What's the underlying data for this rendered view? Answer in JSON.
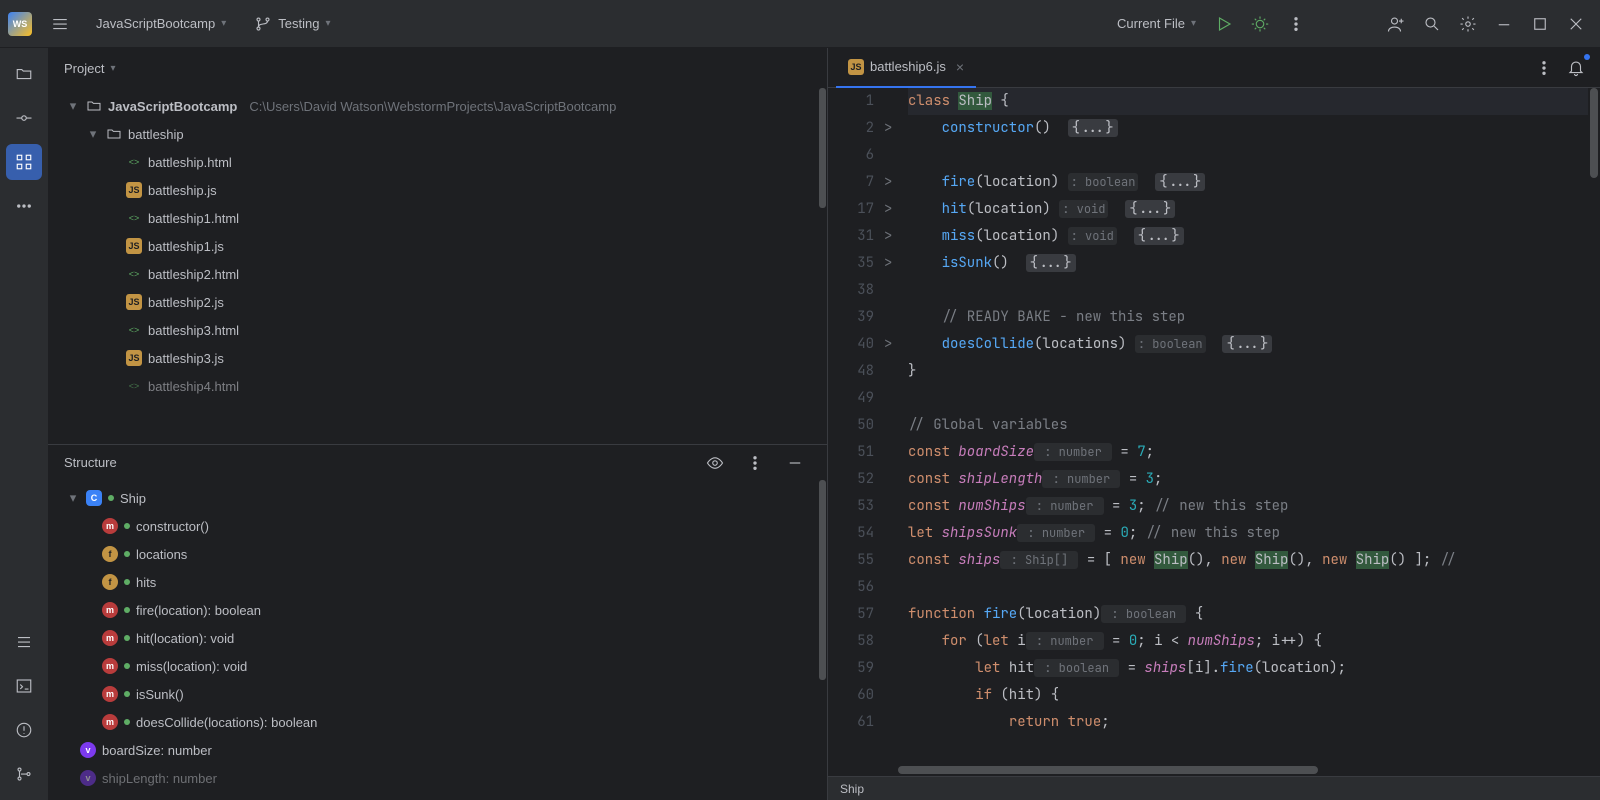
{
  "titlebar": {
    "project": "JavaScriptBootcamp",
    "branch": "Testing",
    "run_config": "Current File"
  },
  "sidebar": {
    "panel_title": "Project",
    "root": {
      "name": "JavaScriptBootcamp",
      "path": "C:\\Users\\David Watson\\WebstormProjects\\JavaScriptBootcamp"
    },
    "folder": "battleship",
    "files": [
      "battleship.html",
      "battleship.js",
      "battleship1.html",
      "battleship1.js",
      "battleship2.html",
      "battleship2.js",
      "battleship3.html",
      "battleship3.js",
      "battleship4.html"
    ]
  },
  "structure": {
    "title": "Structure",
    "class": "Ship",
    "members": [
      {
        "icon": "m",
        "label": "constructor()"
      },
      {
        "icon": "f",
        "label": "locations"
      },
      {
        "icon": "f",
        "label": "hits"
      },
      {
        "icon": "m",
        "label": "fire(location): boolean"
      },
      {
        "icon": "m",
        "label": "hit(location): void"
      },
      {
        "icon": "m",
        "label": "miss(location): void"
      },
      {
        "icon": "m",
        "label": "isSunk()"
      },
      {
        "icon": "m",
        "label": "doesCollide(locations): boolean"
      }
    ],
    "globals": [
      {
        "icon": "v",
        "label": "boardSize: number"
      },
      {
        "icon": "v",
        "label": "shipLength: number"
      }
    ]
  },
  "editor": {
    "tab": "battleship6.js",
    "lineNumbers": [
      "1",
      "2",
      "6",
      "7",
      "17",
      "31",
      "35",
      "38",
      "39",
      "40",
      "48",
      "49",
      "50",
      "51",
      "52",
      "53",
      "54",
      "55",
      "56",
      "57",
      "58",
      "59",
      "60",
      "61"
    ],
    "foldMarks": {
      "2": ">",
      "7": ">",
      "17": ">",
      "31": ">",
      "35": ">",
      "40": ">"
    }
  },
  "code": {
    "l1_kw": "class ",
    "l1_cls": "Ship",
    "l1_rest": " {",
    "l2_fn": "constructor",
    "l2_paren": "()  ",
    "l2_fold": "{...}",
    "l7_fn": "fire",
    "l7_args": "(location)",
    "l7_hint": ": boolean",
    "l7_fold": "{...}",
    "l17_fn": "hit",
    "l17_args": "(location)",
    "l17_hint": ": void",
    "l17_fold": "{...}",
    "l31_fn": "miss",
    "l31_args": "(location)",
    "l31_hint": ": void",
    "l31_fold": "{...}",
    "l35_fn": "isSunk",
    "l35_args": "()",
    "l35_fold": "{...}",
    "l39_cmt": "// READY BAKE - new this step",
    "l40_fn": "doesCollide",
    "l40_args": "(locations)",
    "l40_hint": ": boolean",
    "l40_fold": "{...}",
    "l48": "}",
    "l50_cmt": "// Global variables",
    "l51_kw": "const ",
    "l51_var": "boardSize",
    "l51_hint": " : number ",
    "l51_rest": " = ",
    "l51_num": "7",
    "l51_semi": ";",
    "l52_kw": "const ",
    "l52_var": "shipLength",
    "l52_hint": " : number ",
    "l52_rest": " = ",
    "l52_num": "3",
    "l52_semi": ";",
    "l53_kw": "const ",
    "l53_var": "numShips",
    "l53_hint": " : number ",
    "l53_rest": " = ",
    "l53_num": "3",
    "l53_semi": "; ",
    "l53_cmt": "// new this step",
    "l54_kw": "let ",
    "l54_var": "shipsSunk",
    "l54_hint": " : number ",
    "l54_rest": " = ",
    "l54_num": "0",
    "l54_semi": "; ",
    "l54_cmt": "// new this step",
    "l55_kw": "const ",
    "l55_var": "ships",
    "l55_hint": " : Ship[] ",
    "l55_rest": " = [ ",
    "l55_new": "new ",
    "l55_ship": "Ship",
    "l55_p": "(), ",
    "l55_new2": "new ",
    "l55_ship2": "Ship",
    "l55_p2": "(), ",
    "l55_new3": "new ",
    "l55_ship3": "Ship",
    "l55_p3": "() ]; ",
    "l55_cmt": "//",
    "l57_kw": "function ",
    "l57_fn": "fire",
    "l57_args": "(location)",
    "l57_hint": " : boolean ",
    "l57_rest": " {",
    "l58_kw": "for ",
    "l58_p1": "(",
    "l58_let": "let ",
    "l58_i": "i",
    "l58_hint": " : number ",
    "l58_rest": " = ",
    "l58_z": "0",
    "l58_mid": "; i < ",
    "l58_ns": "numShips",
    "l58_tail": "; i++) {",
    "l59_let": "let ",
    "l59_hit": "hit",
    "l59_hint": " : boolean ",
    "l59_eq": " = ",
    "l59_ships": "ships",
    "l59_br": "[i].",
    "l59_fire": "fire",
    "l59_args": "(location);",
    "l60_if": "if ",
    "l60_cond": "(hit) {",
    "l61_ret": "return ",
    "l61_true": "true",
    "l61_semi": ";"
  },
  "status": {
    "crumb": "Ship"
  }
}
